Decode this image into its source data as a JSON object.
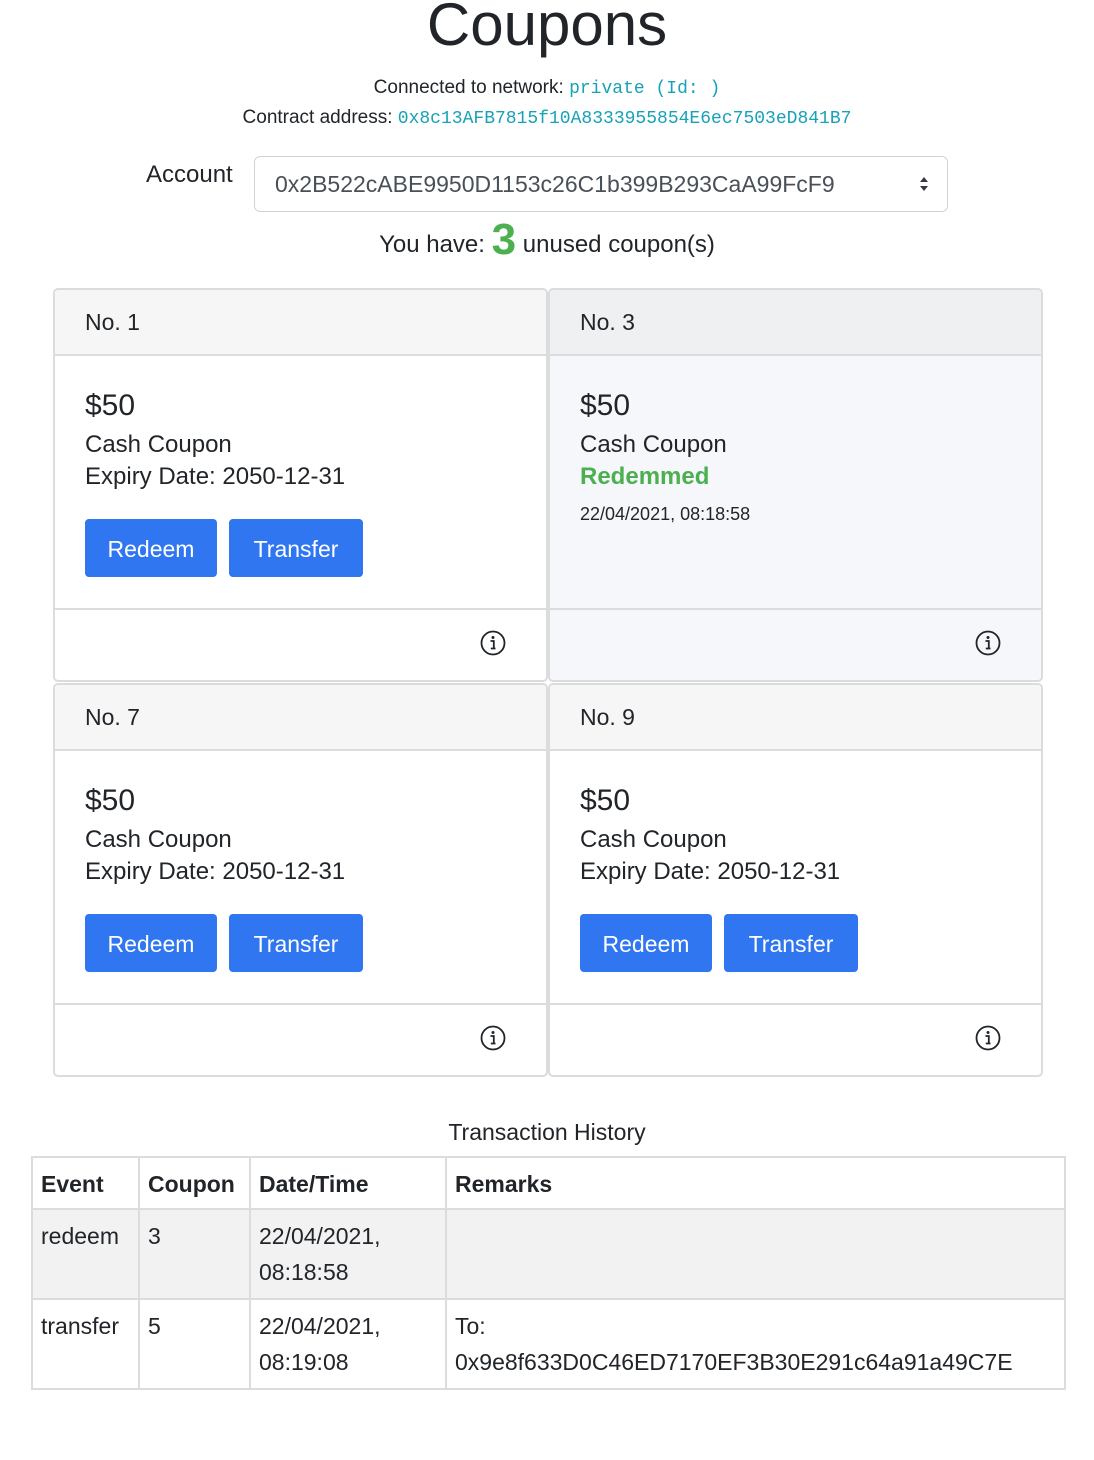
{
  "page": {
    "title": "Coupons",
    "network_label": "Connected to network:",
    "network_value": "private (Id: )",
    "contract_label": "Contract address:",
    "contract_value": "0x8c13AFB7815f10A8333955854E6ec7503eD841B7"
  },
  "account": {
    "label": "Account",
    "selected": "0x2B522cABE9950D1153c26C1b399B293CaA99FcF9"
  },
  "summary": {
    "prefix": "You have:",
    "count": "3",
    "suffix": "unused coupon(s)"
  },
  "coupons": [
    {
      "header": "No. 1",
      "amount": "$50",
      "type": "Cash Coupon",
      "expiry": "Expiry Date: 2050-12-31",
      "redeem_label": "Redeem",
      "transfer_label": "Transfer"
    },
    {
      "header": "No. 3",
      "amount": "$50",
      "type": "Cash Coupon",
      "status": "Redemmed",
      "redeemed_at": "22/04/2021, 08:18:58"
    },
    {
      "header": "No. 7",
      "amount": "$50",
      "type": "Cash Coupon",
      "expiry": "Expiry Date: 2050-12-31",
      "redeem_label": "Redeem",
      "transfer_label": "Transfer"
    },
    {
      "header": "No. 9",
      "amount": "$50",
      "type": "Cash Coupon",
      "expiry": "Expiry Date: 2050-12-31",
      "redeem_label": "Redeem",
      "transfer_label": "Transfer"
    }
  ],
  "history": {
    "title": "Transaction History",
    "columns": [
      "Event",
      "Coupon",
      "Date/Time",
      "Remarks"
    ],
    "rows": [
      {
        "event": "redeem",
        "coupon": "3",
        "date": "22/04/2021,",
        "time": "08:18:58",
        "remarks_line1": "",
        "remarks_line2": ""
      },
      {
        "event": "transfer",
        "coupon": "5",
        "date": "22/04/2021,",
        "time": "08:19:08",
        "remarks_line1": "To:",
        "remarks_line2": "0x9e8f633D0C46ED7170EF3B30E291c64a91a49C7E"
      }
    ]
  },
  "colors": {
    "primary_button": "#2f76f0",
    "success_text": "#4caf50",
    "mono_text": "#17a2b8"
  },
  "icons": {
    "info": "info-circle-icon",
    "select_arrows": "sort-arrows-icon"
  }
}
